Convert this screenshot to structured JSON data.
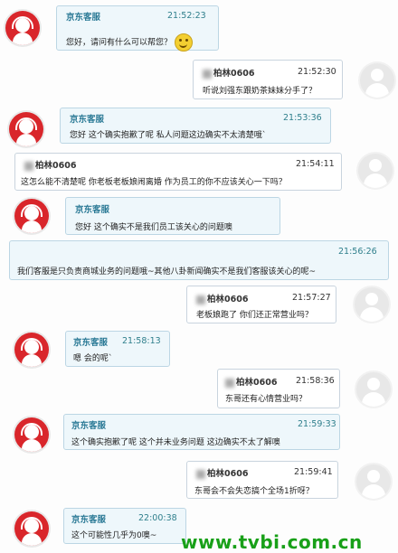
{
  "messages": [
    {
      "side": "cs",
      "sender": "京东客服",
      "time": "21:52:23",
      "text": "您好，请问有什么可以帮您？"
    },
    {
      "side": "user",
      "sender": "柏林0606",
      "time": "21:52:30",
      "text": "听说刘强东跟奶茶妹妹分手了？"
    },
    {
      "side": "cs",
      "sender": "京东客服",
      "time": "21:53:36",
      "text": "您好  这个确实抱歉了呢  私人问题这边确实不太清楚哦`"
    },
    {
      "side": "user",
      "sender": "柏林0606",
      "time": "21:54:11",
      "text": "这怎么能不清楚呢  你老板老板娘闹离婚  作为员工的你不应该关心一下吗？"
    },
    {
      "side": "cs",
      "sender": "京东客服",
      "time": "",
      "text": "您好  这个确实不是我们员工该关心的问题噢"
    },
    {
      "side": "cs-wide",
      "sender": "",
      "time": "21:56:26",
      "text": "我们客服是只负责商城业务的问题哦~其他八卦新闻确实不是我们客服该关心的呢~"
    },
    {
      "side": "user",
      "sender": "柏林0606",
      "time": "21:57:27",
      "text": "老板娘跑了 你们还正常营业吗？"
    },
    {
      "side": "cs",
      "sender": "京东客服",
      "time": "21:58:13",
      "text": "嗯  会的呢`"
    },
    {
      "side": "user",
      "sender": "柏林0606",
      "time": "21:58:36",
      "text": "东哥还有心情营业吗？"
    },
    {
      "side": "cs",
      "sender": "京东客服",
      "time": "21:59:33",
      "text": "这个确实抱歉了呢  这个并未业务问题  这边确实不太了解噢"
    },
    {
      "side": "user",
      "sender": "柏林0606",
      "time": "21:59:41",
      "text": "东哥会不会失恋搞个全场1折呀？"
    },
    {
      "side": "cs",
      "sender": "京东客服",
      "time": "22:00:38",
      "text": "这个可能性几乎为0噢~"
    }
  ],
  "watermark": "www.tvbi.com.cn",
  "colors": {
    "cs_avatar": "#d9262b",
    "cs_bubble": "#eef7fb",
    "user_bubble": "#ffffff",
    "sender_cs": "#2b7a96",
    "watermark": "#18a018"
  }
}
